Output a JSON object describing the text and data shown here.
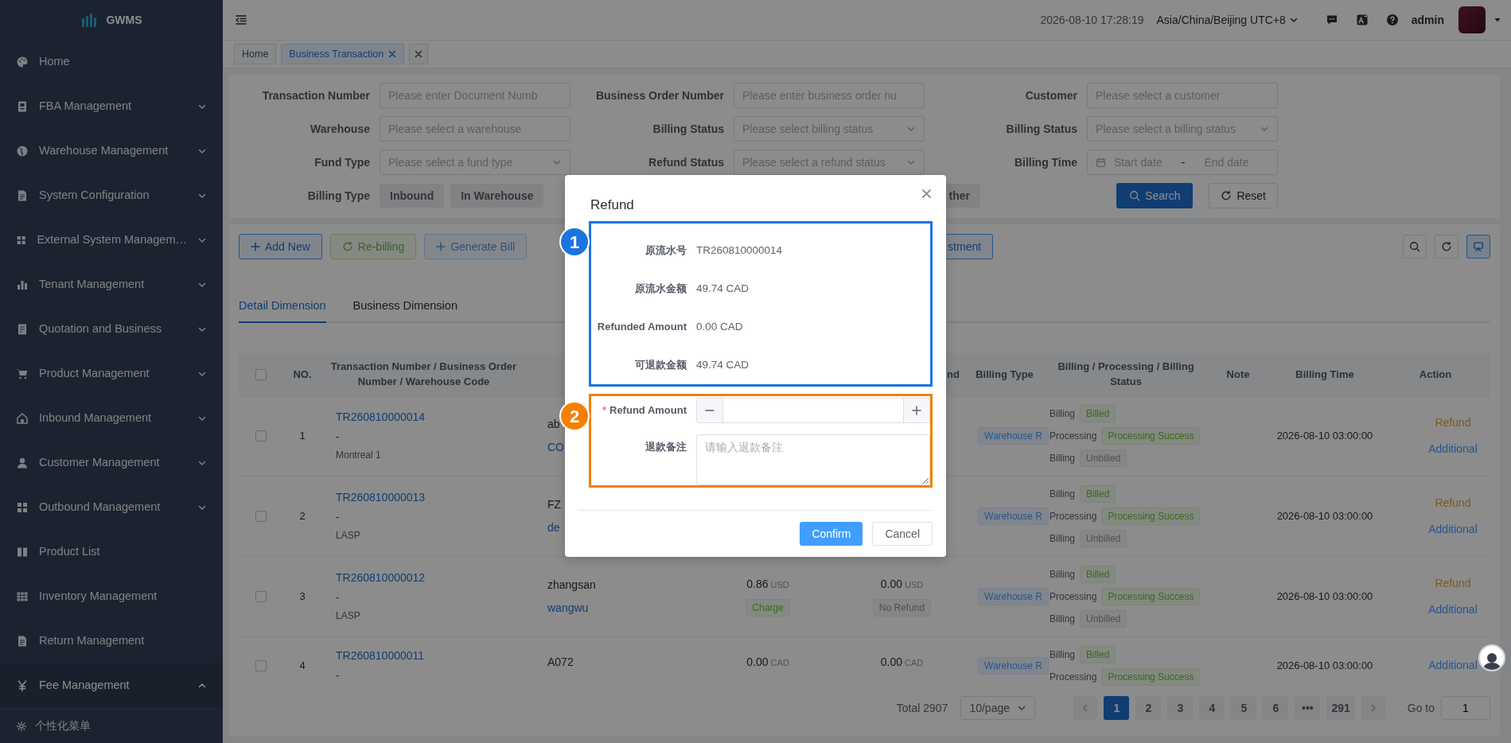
{
  "sidebar": {
    "logo": "GWMS",
    "items": [
      {
        "label": "Home",
        "kind": "link",
        "expanded": false
      },
      {
        "label": "FBA Management",
        "kind": "group",
        "expanded": false
      },
      {
        "label": "Warehouse Management",
        "kind": "group",
        "expanded": false
      },
      {
        "label": "System Configuration",
        "kind": "group",
        "expanded": false
      },
      {
        "label": "External System Managem…",
        "kind": "group",
        "expanded": false
      },
      {
        "label": "Tenant Management",
        "kind": "group",
        "expanded": false
      },
      {
        "label": "Quotation and Business",
        "kind": "group",
        "expanded": false
      },
      {
        "label": "Product Management",
        "kind": "group",
        "expanded": false
      },
      {
        "label": "Inbound Management",
        "kind": "group",
        "expanded": false
      },
      {
        "label": "Customer Management",
        "kind": "group",
        "expanded": false
      },
      {
        "label": "Outbound Management",
        "kind": "group",
        "expanded": false
      },
      {
        "label": "Product List",
        "kind": "link",
        "expanded": false
      },
      {
        "label": "Inventory Management",
        "kind": "link",
        "expanded": false
      },
      {
        "label": "Return Management",
        "kind": "link",
        "expanded": false
      },
      {
        "label": "Fee Management",
        "kind": "group",
        "expanded": true
      }
    ],
    "footer": "个性化菜单"
  },
  "header": {
    "datetime": "2026-08-10 17:28:19",
    "timezone": "Asia/China/Beijing UTC+8",
    "user": "admin"
  },
  "page_tabs": [
    {
      "label": "Home",
      "selected": false,
      "closable": false
    },
    {
      "label": "Business Transaction",
      "selected": true,
      "closable": true
    }
  ],
  "filters": [
    {
      "label": "Transaction Number",
      "kind": "input",
      "placeholder": "Please enter Document Numb"
    },
    {
      "label": "Business Order Number",
      "kind": "input",
      "placeholder": "Please enter business order nu"
    },
    {
      "label": "Customer",
      "kind": "input",
      "placeholder": "Please select a customer"
    },
    {
      "label": "Warehouse",
      "kind": "input",
      "placeholder": "Please select a warehouse"
    },
    {
      "label": "Billing Status",
      "kind": "select",
      "placeholder": "Please select billing status"
    },
    {
      "label": "Billing Status",
      "kind": "select",
      "placeholder": "Please select a billing status"
    },
    {
      "label": "Fund Type",
      "kind": "select",
      "placeholder": "Please select a fund type"
    },
    {
      "label": "Refund Status",
      "kind": "select",
      "placeholder": "Please select a refund status"
    },
    {
      "label": "Billing Time",
      "kind": "daterange",
      "start": "Start date",
      "separator": "-",
      "end": "End date"
    }
  ],
  "billing_type": {
    "label": "Billing Type",
    "options": [
      {
        "label": "Inbound",
        "selected": false
      },
      {
        "label": "In Warehouse",
        "selected": false
      },
      {
        "label": "ther",
        "selected": false
      }
    ]
  },
  "filter_buttons": {
    "search": "Search",
    "reset": "Reset"
  },
  "toolbar": [
    {
      "label": "Add New",
      "kind": "add",
      "disabled": false
    },
    {
      "label": "Re-billing",
      "kind": "rebill",
      "disabled": true
    },
    {
      "label": "Generate Bill",
      "kind": "add",
      "disabled": true
    },
    {
      "label": "stment",
      "kind": "plain",
      "disabled": false
    }
  ],
  "view_buttons": [
    {
      "kind": "search",
      "selected": false
    },
    {
      "kind": "refresh",
      "selected": false
    },
    {
      "kind": "display",
      "selected": true
    }
  ],
  "dimension_tabs": [
    {
      "label": "Detail Dimension",
      "selected": true
    },
    {
      "label": "Business Dimension",
      "selected": false
    }
  ],
  "table": {
    "all_checked": false,
    "columns": [
      "NO.",
      "Transaction Number / Business Order Number / Warehouse Code",
      "nd",
      "Billing Type",
      "Billing / Processing / Billing Status",
      "Note",
      "Billing Time",
      "Action"
    ],
    "rows": [
      {
        "checked": false,
        "no": "1",
        "transaction": "TR260810000014",
        "order": "-",
        "warehouse": "Montreal 1",
        "party": "ab",
        "party_2": "CO",
        "billing_type": "Warehouse R",
        "statuses": [
          {
            "label": "Billing",
            "tag": "Billed",
            "kind": "success"
          },
          {
            "label": "Processing",
            "tag": "Processing Success",
            "kind": "success"
          },
          {
            "label": "Billing",
            "tag": "Unbilled",
            "kind": "info"
          }
        ],
        "billing_time": "2026-08-10 03:00:00",
        "actions": [
          {
            "label": "Refund",
            "kind": "warning"
          },
          {
            "label": "Additional",
            "kind": "primary"
          }
        ]
      },
      {
        "checked": false,
        "no": "2",
        "transaction": "TR260810000013",
        "order": "-",
        "warehouse": "LASP",
        "party": "FZ",
        "party_2": "de",
        "billing_type": "Warehouse R",
        "statuses": [
          {
            "label": "Billing",
            "tag": "Billed",
            "kind": "success"
          },
          {
            "label": "Processing",
            "tag": "Processing Success",
            "kind": "success"
          },
          {
            "label": "Billing",
            "tag": "Unbilled",
            "kind": "info"
          }
        ],
        "billing_time": "2026-08-10 03:00:00",
        "actions": [
          {
            "label": "Refund",
            "kind": "warning"
          },
          {
            "label": "Additional",
            "kind": "primary"
          }
        ]
      },
      {
        "checked": false,
        "no": "3",
        "transaction": "TR260810000012",
        "order": "-",
        "warehouse": "LASP",
        "party": "zhangsan",
        "party_2": "wangwu",
        "amount": {
          "value": "0.86",
          "currency": "USD",
          "tag": "Charge",
          "kind": "success"
        },
        "refund": {
          "value": "0.00",
          "currency": "USD",
          "tag": "No Refund",
          "kind": "info"
        },
        "billing_type": "Warehouse R",
        "statuses": [
          {
            "label": "Billing",
            "tag": "Billed",
            "kind": "success"
          },
          {
            "label": "Processing",
            "tag": "Processing Success",
            "kind": "success"
          },
          {
            "label": "Billing",
            "tag": "Unbilled",
            "kind": "info"
          }
        ],
        "billing_time": "2026-08-10 03:00:00",
        "actions": [
          {
            "label": "Refund",
            "kind": "warning"
          },
          {
            "label": "Additional",
            "kind": "primary"
          }
        ]
      },
      {
        "checked": false,
        "no": "4",
        "transaction": "TR260810000011",
        "order": "-",
        "party": "A072",
        "amount": {
          "value": "0.00",
          "currency": "CAD"
        },
        "refund": {
          "value": "0.00",
          "currency": "CAD"
        },
        "billing_type": "Warehouse R",
        "statuses": [
          {
            "label": "Billing",
            "tag": "Billed",
            "kind": "success"
          },
          {
            "label": "Processing",
            "tag": "Processing Success",
            "kind": "success"
          }
        ],
        "billing_time": "2026-08-10 03:00:00",
        "actions": [
          {
            "label": "Additional",
            "kind": "primary"
          }
        ]
      }
    ]
  },
  "pagination": {
    "total": "Total 2907",
    "page_size": "10/page",
    "pages": [
      {
        "label": "1",
        "selected": true
      },
      {
        "label": "2",
        "selected": false
      },
      {
        "label": "3",
        "selected": false
      },
      {
        "label": "4",
        "selected": false
      },
      {
        "label": "5",
        "selected": false
      },
      {
        "label": "6",
        "selected": false
      },
      {
        "label": "•••",
        "selected": false
      },
      {
        "label": "291",
        "selected": false
      }
    ],
    "goto_label": "Go to",
    "goto_value": "1"
  },
  "modal": {
    "title": "Refund",
    "sections": [
      {
        "marker": "1",
        "color": "#1b74e0",
        "fields": [
          {
            "kind": "display",
            "label": "原流水号",
            "value": "TR260810000014"
          },
          {
            "kind": "display",
            "label": "原流水金额",
            "value": "49.74 CAD"
          },
          {
            "kind": "display",
            "label": "Refunded Amount",
            "value": "0.00 CAD"
          },
          {
            "kind": "display",
            "label": "可退款金额",
            "value": "49.74 CAD"
          }
        ]
      },
      {
        "marker": "2",
        "color": "#f58000",
        "fields": [
          {
            "kind": "number",
            "label": "Refund Amount",
            "required_mark": "*"
          },
          {
            "kind": "textarea",
            "label": "退款备注",
            "placeholder": "请输入退款备注"
          }
        ]
      }
    ],
    "buttons": {
      "confirm": "Confirm",
      "cancel": "Cancel"
    }
  }
}
